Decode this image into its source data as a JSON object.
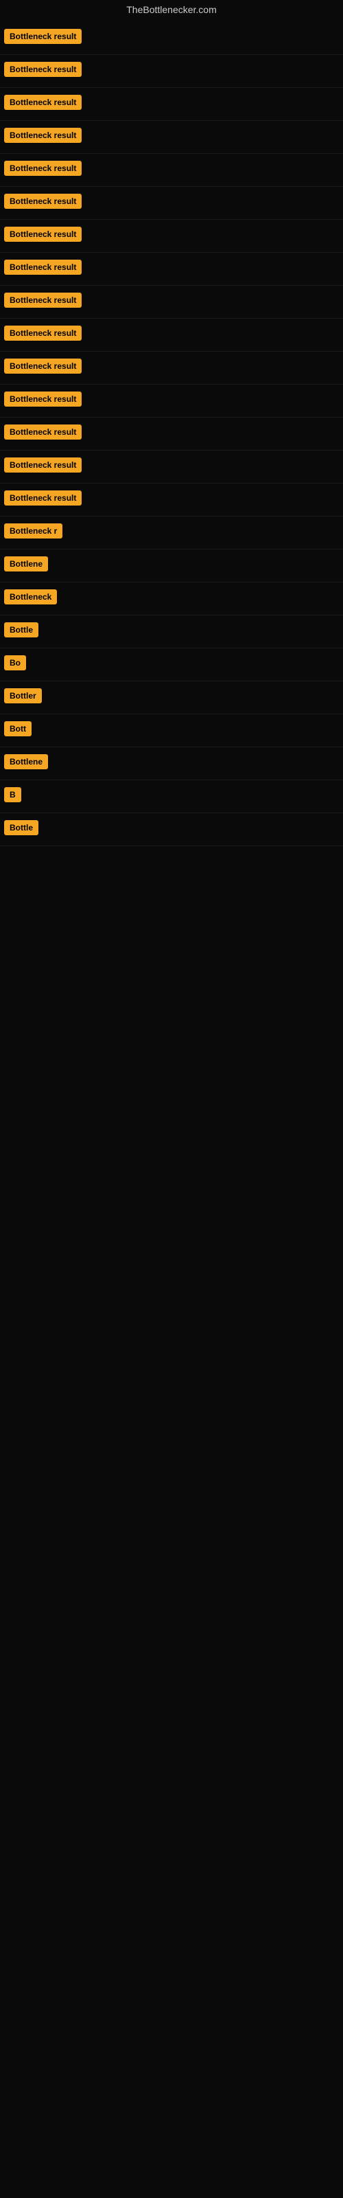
{
  "site": {
    "title": "TheBottlenecker.com"
  },
  "rows": [
    {
      "id": 1,
      "label": "Bottleneck result",
      "truncated": false
    },
    {
      "id": 2,
      "label": "Bottleneck result",
      "truncated": false
    },
    {
      "id": 3,
      "label": "Bottleneck result",
      "truncated": false
    },
    {
      "id": 4,
      "label": "Bottleneck result",
      "truncated": false
    },
    {
      "id": 5,
      "label": "Bottleneck result",
      "truncated": false
    },
    {
      "id": 6,
      "label": "Bottleneck result",
      "truncated": false
    },
    {
      "id": 7,
      "label": "Bottleneck result",
      "truncated": false
    },
    {
      "id": 8,
      "label": "Bottleneck result",
      "truncated": false
    },
    {
      "id": 9,
      "label": "Bottleneck result",
      "truncated": false
    },
    {
      "id": 10,
      "label": "Bottleneck result",
      "truncated": false
    },
    {
      "id": 11,
      "label": "Bottleneck result",
      "truncated": false
    },
    {
      "id": 12,
      "label": "Bottleneck result",
      "truncated": false
    },
    {
      "id": 13,
      "label": "Bottleneck result",
      "truncated": false
    },
    {
      "id": 14,
      "label": "Bottleneck result",
      "truncated": false
    },
    {
      "id": 15,
      "label": "Bottleneck result",
      "truncated": false
    },
    {
      "id": 16,
      "label": "Bottleneck r",
      "truncated": true
    },
    {
      "id": 17,
      "label": "Bottlene",
      "truncated": true
    },
    {
      "id": 18,
      "label": "Bottleneck",
      "truncated": true
    },
    {
      "id": 19,
      "label": "Bottle",
      "truncated": true
    },
    {
      "id": 20,
      "label": "Bo",
      "truncated": true
    },
    {
      "id": 21,
      "label": "Bottler",
      "truncated": true
    },
    {
      "id": 22,
      "label": "Bott",
      "truncated": true
    },
    {
      "id": 23,
      "label": "Bottlene",
      "truncated": true
    },
    {
      "id": 24,
      "label": "B",
      "truncated": true
    },
    {
      "id": 25,
      "label": "Bottle",
      "truncated": true
    }
  ]
}
